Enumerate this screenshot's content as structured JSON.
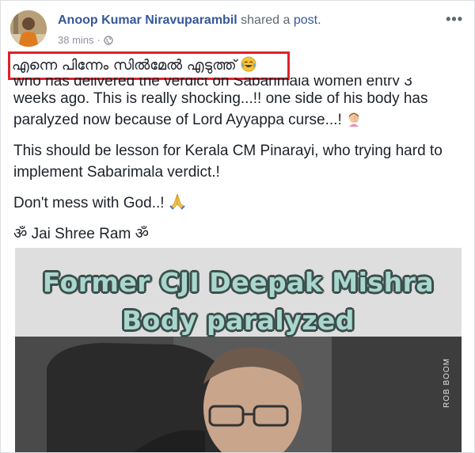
{
  "post": {
    "author": "Anoop Kumar Niravuparambil",
    "action_prefix": "shared a",
    "action_link": "post.",
    "time": "38 mins",
    "separator": "·",
    "highlighted_text": "എന്നെ പിന്നേം സിൽമേൽ എടുത്ത്",
    "cut_off_line": "who has delivered the verdict on Sabarimala women entry 3",
    "paragraph1": "weeks ago. This is really shocking...!! one side of his body has paralyzed now because of Lord Ayyappa curse...!",
    "paragraph2": "This should be lesson for Kerala CM Pinarayi, who trying hard to implement Sabarimala verdict.!",
    "paragraph3": "Don't mess with God..!",
    "paragraph4_word": "Jai Shree Ram",
    "om_symbol": "ॐ"
  },
  "image": {
    "title_line1": "Former CJI Deepak Mishra",
    "title_line2": "Body paralyzed",
    "watermark": "ROB BOOM"
  },
  "colors": {
    "link": "#365899",
    "highlight_border": "#e0222a",
    "meme_text": "#a9d7cf"
  }
}
